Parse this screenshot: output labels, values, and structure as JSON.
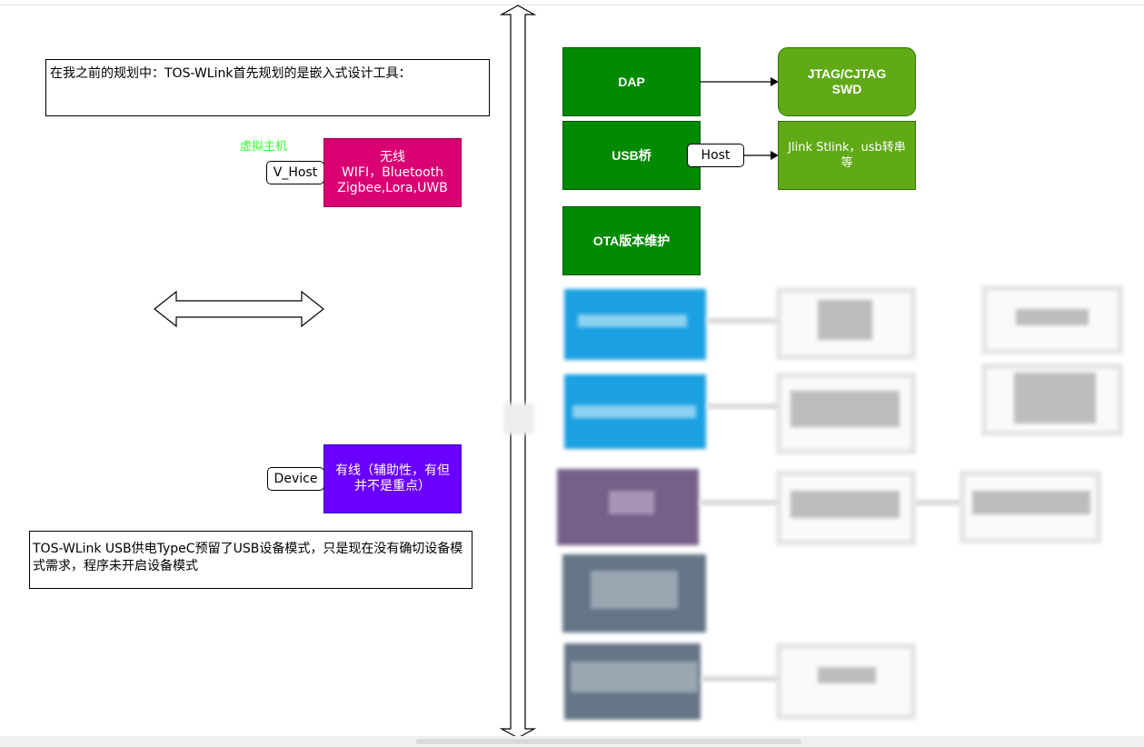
{
  "left": {
    "note_top": "在我之前的规划中：TOS-WLink首先规划的是嵌入式设计工具：",
    "virtual_host_label": "虚拟主机",
    "v_host_tag": "V_Host",
    "wireless_box": {
      "line1": "无线",
      "line2": "WIFI，Bluetooth",
      "line3": "Zigbee,Lora,UWB"
    },
    "device_tag": "Device",
    "wired_box": "有线（辅助性，有但并不是重点）",
    "note_bottom": "TOS-WLink USB供电TypeC预留了USB设备模式，只是现在没有确切设备模式需求，程序未开启设备模式"
  },
  "right": {
    "dap": "DAP",
    "jtag_line1": "JTAG/CJTAG",
    "jtag_line2": "SWD",
    "usb_bridge": "USB桥",
    "host_tag": "Host",
    "jlink_line1": "Jlink Stlink，usb转串",
    "jlink_line2": "等",
    "ota": "OTA版本维护"
  },
  "colors": {
    "dark_green": "#008a00",
    "light_green": "#60a917",
    "magenta": "#d80073",
    "violet": "#6a00ff",
    "blue": "#1ba1e2",
    "purple": "#76608a",
    "slate": "#647687",
    "label_green": "#33ff33"
  },
  "icons": {
    "double_arrow_horizontal": "double-arrow-horizontal-icon",
    "double_arrow_vertical": "double-arrow-vertical-icon",
    "arrow_right": "arrow-right-icon"
  }
}
